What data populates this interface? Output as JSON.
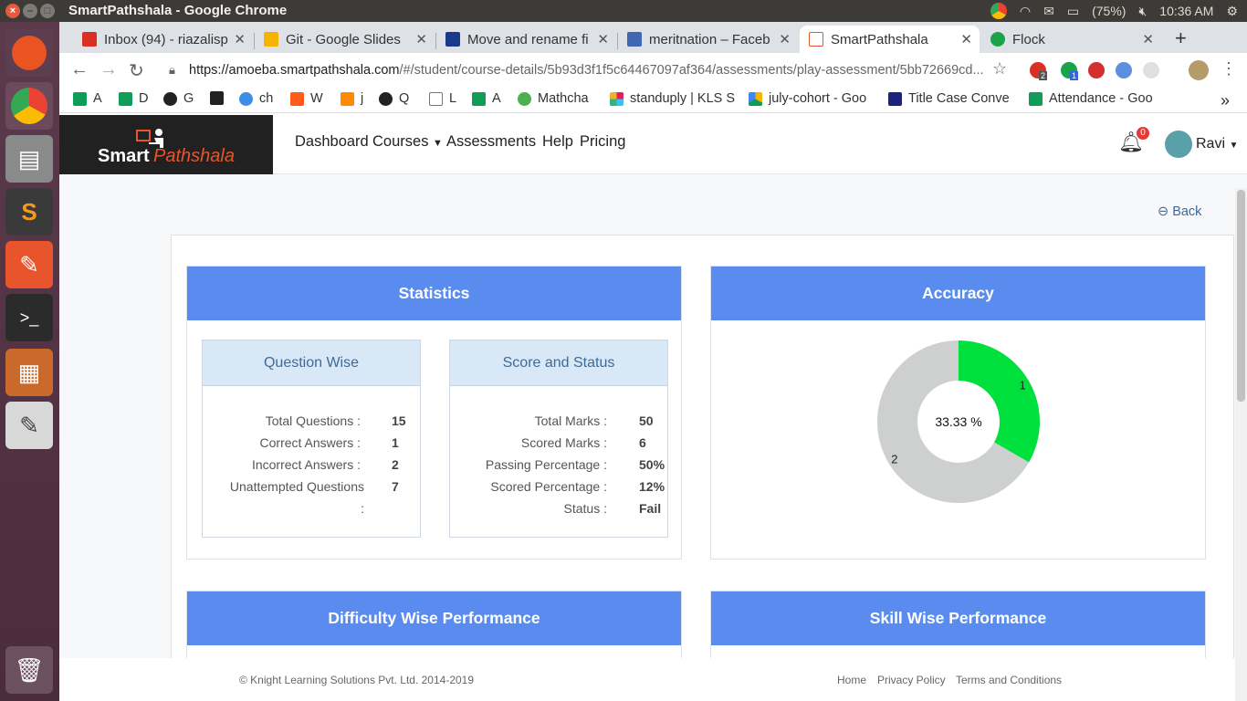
{
  "os": {
    "window_title": "SmartPathshala - Google Chrome",
    "battery": "(75%)",
    "clock": "10:36 AM"
  },
  "browser": {
    "tabs": [
      {
        "label": "Inbox (94) - riazalisp",
        "icon": "gmail-icon",
        "color": "#d93025"
      },
      {
        "label": "Git - Google Slides",
        "icon": "slides-icon",
        "color": "#f4b400"
      },
      {
        "label": "Move and rename fi",
        "icon": "video-icon",
        "color": "#1a3a8a"
      },
      {
        "label": "meritnation – Faceb",
        "icon": "facebook-icon",
        "color": "#4267b2"
      },
      {
        "label": "SmartPathshala",
        "icon": "page-icon",
        "color": "#e8542b",
        "active": true
      },
      {
        "label": "Flock",
        "icon": "flock-icon",
        "color": "#1aa34a"
      }
    ],
    "url_host": "https://amoeba.smartpathshala.com",
    "url_path": "/#/student/course-details/5b93d3f1f5c64467097af364/assessments/play-assessment/5bb72669cd...",
    "extension_badges": [
      "2",
      "1"
    ],
    "bookmarks": [
      {
        "label": "A",
        "color": "#0f9d58"
      },
      {
        "label": "D",
        "color": "#0f9d58"
      },
      {
        "label": "G",
        "color": "#222"
      },
      {
        "label": "",
        "color": "#222"
      },
      {
        "label": "ch",
        "color": "#3a8ee6"
      },
      {
        "label": "W",
        "color": "#ff5c1a"
      },
      {
        "label": "j",
        "color": "#ff8c00"
      },
      {
        "label": "Q",
        "color": "#222"
      },
      {
        "label": "L",
        "color": "#999"
      },
      {
        "label": "A",
        "color": "#0f9d58"
      },
      {
        "label": "Mathcha",
        "color": "#4caf50"
      },
      {
        "label": "standuply | KLS S",
        "color": "#e01e5a"
      },
      {
        "label": "july-cohort - Goo",
        "color": "#f4b400"
      },
      {
        "label": "Title Case Conve",
        "color": "#1a237e"
      },
      {
        "label": "Attendance - Goo",
        "color": "#0f9d58"
      }
    ]
  },
  "site": {
    "logo_word1": "Smart",
    "logo_word2": "Pathshala",
    "nav": [
      "Dashboard",
      "Courses",
      "Assessments",
      "Help",
      "Pricing"
    ],
    "notification_count": "0",
    "user_name": "Ravi",
    "back_label": "Back"
  },
  "statistics": {
    "title": "Statistics",
    "question_wise": {
      "title": "Question Wise",
      "rows": [
        {
          "label": "Total Questions :",
          "value": "15"
        },
        {
          "label": "Correct Answers :",
          "value": "1"
        },
        {
          "label": "Incorrect Answers :",
          "value": "2"
        },
        {
          "label": "Unattempted Questions",
          "label2": ":",
          "value": "7"
        }
      ]
    },
    "score_status": {
      "title": "Score and Status",
      "rows": [
        {
          "label": "Total Marks :",
          "value": "50"
        },
        {
          "label": "Scored Marks :",
          "value": "6"
        },
        {
          "label": "Passing Percentage :",
          "value": "50%"
        },
        {
          "label": "Scored Percentage :",
          "value": "12%"
        },
        {
          "label": "Status :",
          "value": "Fail"
        }
      ]
    }
  },
  "accuracy": {
    "title": "Accuracy",
    "center_label": "33.33 %"
  },
  "chart_data": {
    "type": "pie",
    "donut": true,
    "slices": [
      {
        "label": "1",
        "value": 1,
        "color": "#00e03c"
      },
      {
        "label": "2",
        "value": 2,
        "color": "#cdd0cf"
      }
    ]
  },
  "difficulty": {
    "title": "Difficulty Wise Performance"
  },
  "skill": {
    "title": "Skill Wise Performance"
  },
  "footer": {
    "copyright": "© Knight Learning Solutions Pvt. Ltd. 2014-2019",
    "links": [
      "Home",
      "Privacy Policy",
      "Terms and Conditions"
    ]
  }
}
